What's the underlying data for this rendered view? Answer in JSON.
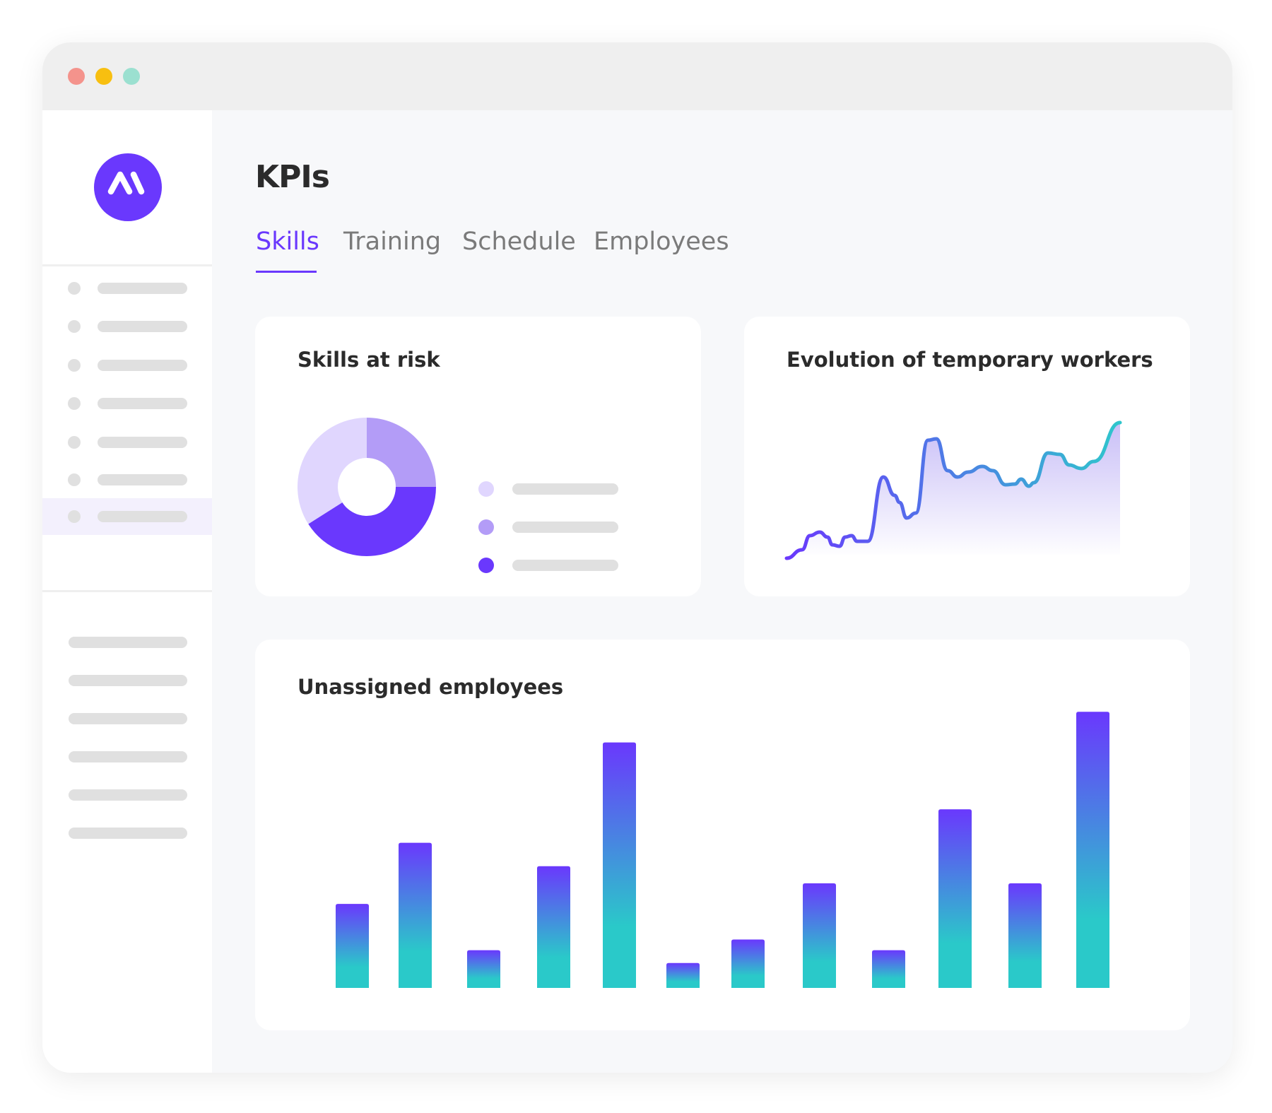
{
  "window": {
    "controls": [
      {
        "name": "close",
        "color": "#f4938c"
      },
      {
        "name": "minimize",
        "color": "#f8bf10"
      },
      {
        "name": "maximize",
        "color": "#9be0d0"
      }
    ]
  },
  "sidebar": {
    "logo": {
      "icon": "brand-logo-icon",
      "color": "#6a38fd"
    },
    "nav_items": [
      {
        "active": false
      },
      {
        "active": false
      },
      {
        "active": false
      },
      {
        "active": false
      },
      {
        "active": false
      },
      {
        "active": false
      },
      {
        "active": true
      }
    ],
    "secondary_items": 6
  },
  "header": {
    "title": "KPIs"
  },
  "tabs": [
    {
      "label": "Skills",
      "active": true
    },
    {
      "label": "Training",
      "active": false
    },
    {
      "label": "Schedule",
      "active": false
    },
    {
      "label": "Employees",
      "active": false
    }
  ],
  "colors": {
    "accent": "#6a38fd",
    "teal": "#2ac9c9",
    "placeholder": "#e0e0e0",
    "text": "#2b2b2b",
    "tab_inactive": "#7a7a7a"
  },
  "cards": {
    "skills_at_risk": {
      "title": "Skills at risk"
    },
    "temporary_workers": {
      "title": "Evolution of temporary workers"
    },
    "unassigned": {
      "title": "Unassigned employees"
    }
  },
  "chart_data": [
    {
      "type": "pie",
      "donut": true,
      "title": "Skills at risk",
      "values": [
        25,
        41,
        34
      ],
      "colors": [
        "#b39cf7",
        "#6a38fd",
        "#e0d6fe"
      ],
      "legend_colors": [
        "#e0d6fe",
        "#b39cf7",
        "#6a38fd"
      ],
      "legend": "right"
    },
    {
      "type": "area",
      "title": "Evolution of temporary workers",
      "x": [
        0,
        22,
        33,
        47,
        58,
        65,
        75,
        83,
        92,
        100,
        115,
        137,
        153,
        160,
        170,
        183,
        200,
        212,
        228,
        242,
        257,
        277,
        292,
        310,
        323,
        332,
        343,
        350,
        370,
        387,
        400,
        417,
        435,
        472
      ],
      "y": [
        3,
        15,
        35,
        40,
        33,
        22,
        20,
        33,
        35,
        27,
        27,
        118,
        92,
        82,
        60,
        67,
        170,
        172,
        127,
        118,
        125,
        133,
        127,
        107,
        108,
        115,
        105,
        110,
        152,
        150,
        135,
        130,
        140,
        195
      ],
      "ylim": [
        0,
        200
      ],
      "grid": false,
      "line_gradient": [
        "#6a38fd",
        "#2fc6cc"
      ],
      "fill_gradient": [
        "#c9bff7",
        "#ffffff"
      ]
    },
    {
      "type": "bar",
      "title": "Unassigned employees",
      "values": [
        118,
        204,
        53,
        171,
        345,
        35,
        68,
        147,
        53,
        251,
        147,
        388
      ],
      "ylim": [
        0,
        400
      ],
      "grid": false,
      "bar_gradient": [
        "#6a38fd",
        "#2ac9c9"
      ]
    }
  ]
}
